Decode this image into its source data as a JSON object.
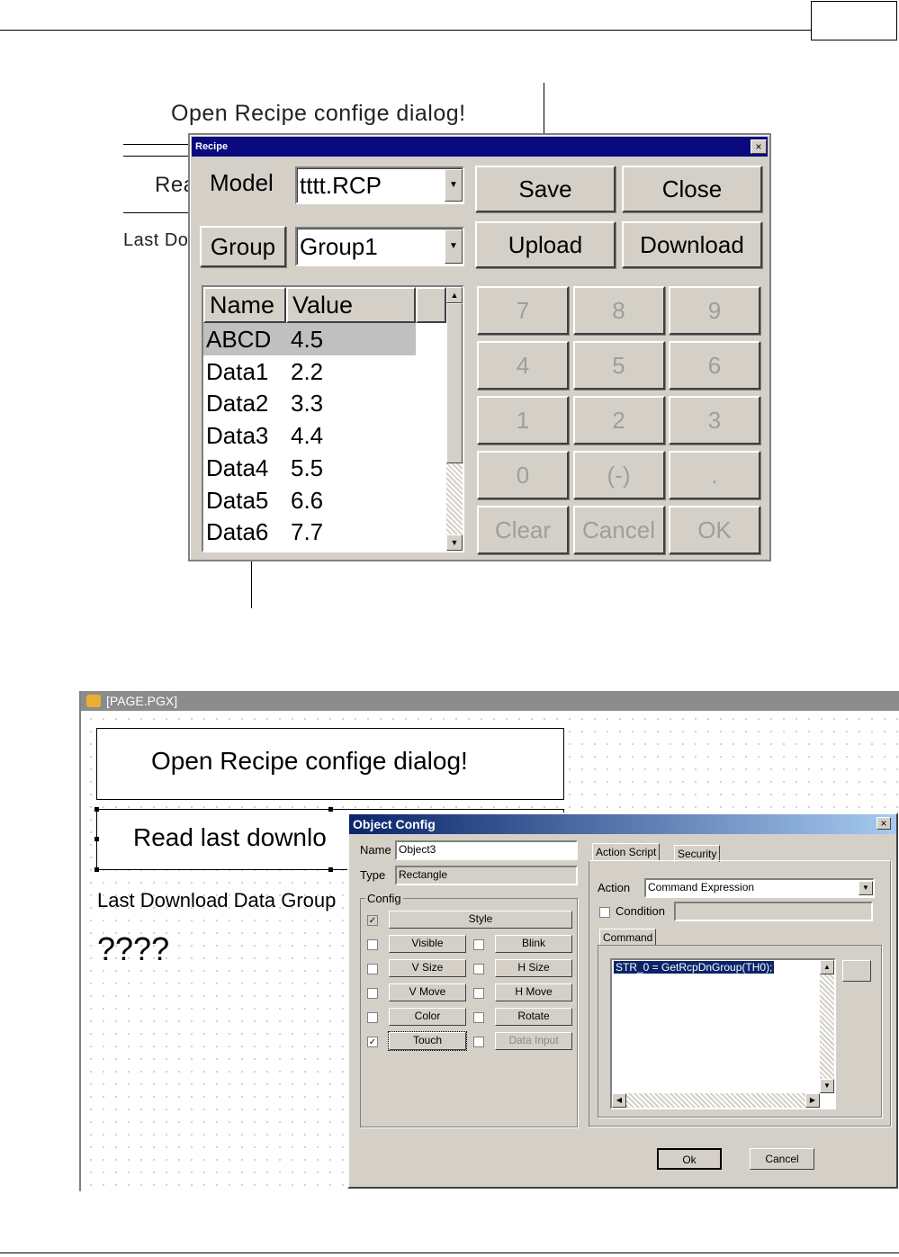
{
  "page": {
    "header_box_text": "",
    "footer_text": ""
  },
  "illustration": {
    "caption_top": "Open Recipe confige dialog!",
    "bg_fragment_1": "Rea",
    "bg_fragment_2": "Last Do"
  },
  "recipe_dialog": {
    "title": "Recipe",
    "close_glyph": "×",
    "model_label": "Model",
    "model_value": "tttt.RCP",
    "group_button": "Group",
    "group_value": "Group1",
    "buttons": {
      "save": "Save",
      "close": "Close",
      "upload": "Upload",
      "download": "Download"
    },
    "list": {
      "headers": [
        "Name",
        "Value"
      ],
      "rows": [
        {
          "name": "ABCD",
          "value": "4.5"
        },
        {
          "name": "Data1",
          "value": "2.2"
        },
        {
          "name": "Data2",
          "value": "3.3"
        },
        {
          "name": "Data3",
          "value": "4.4"
        },
        {
          "name": "Data4",
          "value": "5.5"
        },
        {
          "name": "Data5",
          "value": "6.6"
        },
        {
          "name": "Data6",
          "value": "7.7"
        }
      ],
      "selected_row": 0
    },
    "keypad": [
      "7",
      "8",
      "9",
      "4",
      "5",
      "6",
      "1",
      "2",
      "3",
      "0",
      "(-)",
      ".",
      "Clear",
      "Cancel",
      "OK"
    ]
  },
  "ide": {
    "title": "[PAGE.PGX]",
    "canvas_text_1": "Open Recipe confige dialog!",
    "canvas_text_2": "Read last downlo",
    "canvas_text_3": "Last Download Data Group",
    "canvas_text_4": "????"
  },
  "object_config": {
    "title": "Object Config",
    "close_glyph": "×",
    "name_label": "Name",
    "name_value": "Object3",
    "type_label": "Type",
    "type_value": "Rectangle",
    "config_group": "Config",
    "style_button": "Style",
    "checks": [
      {
        "label": "Visible",
        "checked": false
      },
      {
        "label": "Blink",
        "checked": false
      },
      {
        "label": "V Size",
        "checked": false
      },
      {
        "label": "H Size",
        "checked": false
      },
      {
        "label": "V Move",
        "checked": false
      },
      {
        "label": "H Move",
        "checked": false
      },
      {
        "label": "Color",
        "checked": false
      },
      {
        "label": "Rotate",
        "checked": false
      },
      {
        "label": "Touch",
        "checked": true
      },
      {
        "label": "Data Input",
        "checked": false
      }
    ],
    "tabs": [
      "Action Script",
      "Security"
    ],
    "action_label": "Action",
    "action_value": "Command Expression",
    "condition_label": "Condition",
    "command_tab": "Command",
    "command_text": "STR_0 = GetRcpDnGroup(TH0);",
    "ok_button": "Ok",
    "cancel_button": "Cancel"
  }
}
